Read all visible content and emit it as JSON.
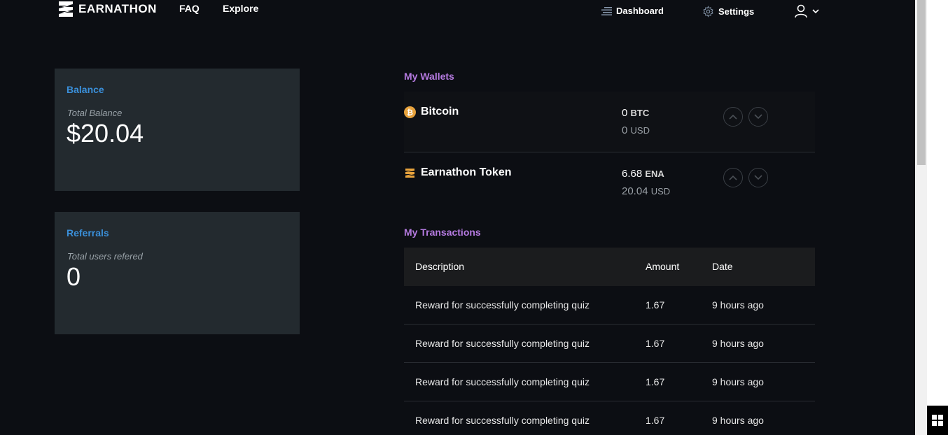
{
  "header": {
    "brand": "EARNATHON",
    "nav": {
      "faq": "FAQ",
      "explore": "Explore"
    },
    "dashboard": "Dashboard",
    "settings": "Settings"
  },
  "balance_card": {
    "title": "Balance",
    "subtitle": "Total Balance",
    "value": "$20.04"
  },
  "referrals_card": {
    "title": "Referrals",
    "subtitle": "Total users refered",
    "value": "0"
  },
  "wallets": {
    "title": "My Wallets",
    "items": [
      {
        "name": "Bitcoin",
        "amount": "0",
        "unit": "BTC",
        "usd": "0",
        "usd_unit": "USD",
        "icon": "bitcoin-icon"
      },
      {
        "name": "Earnathon Token",
        "amount": "6.68",
        "unit": "ENA",
        "usd": "20.04",
        "usd_unit": "USD",
        "icon": "earnathon-token-icon"
      }
    ]
  },
  "transactions": {
    "title": "My Transactions",
    "columns": [
      "Description",
      "Amount",
      "Date"
    ],
    "rows": [
      {
        "description": "Reward for successfully completing quiz",
        "amount": "1.67",
        "date": "9 hours ago"
      },
      {
        "description": "Reward for successfully completing quiz",
        "amount": "1.67",
        "date": "9 hours ago"
      },
      {
        "description": "Reward for successfully completing quiz",
        "amount": "1.67",
        "date": "9 hours ago"
      },
      {
        "description": "Reward for successfully completing quiz",
        "amount": "1.67",
        "date": "9 hours ago"
      }
    ]
  },
  "colors": {
    "accent_blue": "#3a8fd9",
    "accent_purple": "#b57ae0",
    "coin_gold": "#e8a33d"
  }
}
